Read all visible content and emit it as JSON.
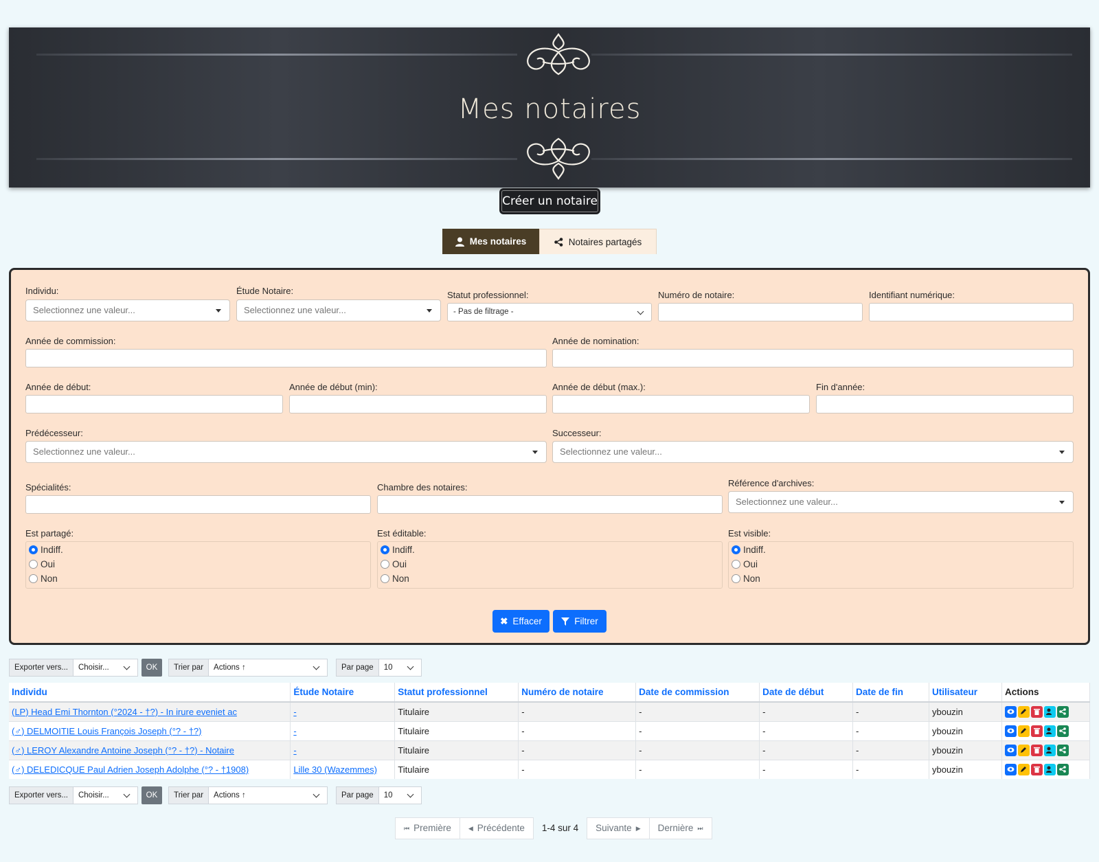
{
  "banner": {
    "title": "Mes notaires"
  },
  "create_button": "Créer un notaire",
  "tabs": [
    {
      "label": "Mes notaires",
      "icon": "user-icon",
      "active": true
    },
    {
      "label": "Notaires partagés",
      "icon": "share-icon",
      "active": false
    }
  ],
  "filters": {
    "individu": {
      "label": "Individu:",
      "placeholder": "Selectionnez une valeur..."
    },
    "etude": {
      "label": "Étude Notaire:",
      "placeholder": "Selectionnez une valeur..."
    },
    "statut": {
      "label": "Statut professionnel:",
      "value": "- Pas de filtrage -"
    },
    "numero": {
      "label": "Numéro de notaire:"
    },
    "identifiant": {
      "label": "Identifiant numérique:"
    },
    "annee_commission": {
      "label": "Année de commission:"
    },
    "annee_nomination": {
      "label": "Année de nomination:"
    },
    "annee_debut": {
      "label": "Année de début:"
    },
    "annee_debut_min": {
      "label": "Année de début (min):"
    },
    "annee_debut_max": {
      "label": "Année de début (max.):"
    },
    "fin_annee": {
      "label": "Fin d'année:"
    },
    "predecesseur": {
      "label": "Prédécesseur:",
      "placeholder": "Selectionnez une valeur..."
    },
    "successeur": {
      "label": "Successeur:",
      "placeholder": "Selectionnez une valeur..."
    },
    "specialites": {
      "label": "Spécialités:"
    },
    "chambre": {
      "label": "Chambre des notaires:"
    },
    "reference": {
      "label": "Référence d'archives:",
      "placeholder": "Selectionnez une valeur..."
    },
    "est_partage": {
      "label": "Est partagé:",
      "options": [
        "Indiff.",
        "Oui",
        "Non"
      ],
      "selected": "Indiff."
    },
    "est_editable": {
      "label": "Est éditable:",
      "options": [
        "Indiff.",
        "Oui",
        "Non"
      ],
      "selected": "Indiff."
    },
    "est_visible": {
      "label": "Est visible:",
      "options": [
        "Indiff.",
        "Oui",
        "Non"
      ],
      "selected": "Indiff."
    },
    "clear_button": "Effacer",
    "filter_button": "Filtrer"
  },
  "toolbar": {
    "export_label": "Exporter vers...",
    "export_choice": "Choisir...",
    "ok": "OK",
    "sort_label": "Trier par",
    "sort_value": "Actions ↑",
    "per_page_label": "Par page",
    "per_page_value": "10"
  },
  "table": {
    "headers": [
      "Individu",
      "Étude Notaire",
      "Statut professionnel",
      "Numéro de notaire",
      "Date de commission",
      "Date de début",
      "Date de fin",
      "Utilisateur",
      "Actions"
    ],
    "rows": [
      [
        "(LP) Head Emi Thornton (°2024 - †?) - In irure eveniet ac",
        "-",
        "Titulaire",
        "-",
        "-",
        "-",
        "-",
        "ybouzin"
      ],
      [
        "(♂) DELMOITIE Louis François Joseph (°? - †?)",
        "-",
        "Titulaire",
        "-",
        "-",
        "-",
        "-",
        "ybouzin"
      ],
      [
        "(♂) LEROY Alexandre Antoine Joseph (°? - †?) - Notaire",
        "-",
        "Titulaire",
        "-",
        "-",
        "-",
        "-",
        "ybouzin"
      ],
      [
        "(♂) DELEDICQUE Paul Adrien Joseph Adolphe (°? - †1908)",
        "Lille 30 (Wazemmes)",
        "Titulaire",
        "-",
        "-",
        "-",
        "-",
        "ybouzin"
      ]
    ],
    "action_colors": {
      "view": "#0d6efd",
      "edit": "#ffc107",
      "delete": "#dc3545",
      "user": "#0dcaf0",
      "share": "#198754"
    }
  },
  "pagination": {
    "first": "Première",
    "prev": "Précédente",
    "info": "1-4 sur 4",
    "next": "Suivante",
    "last": "Dernière"
  }
}
